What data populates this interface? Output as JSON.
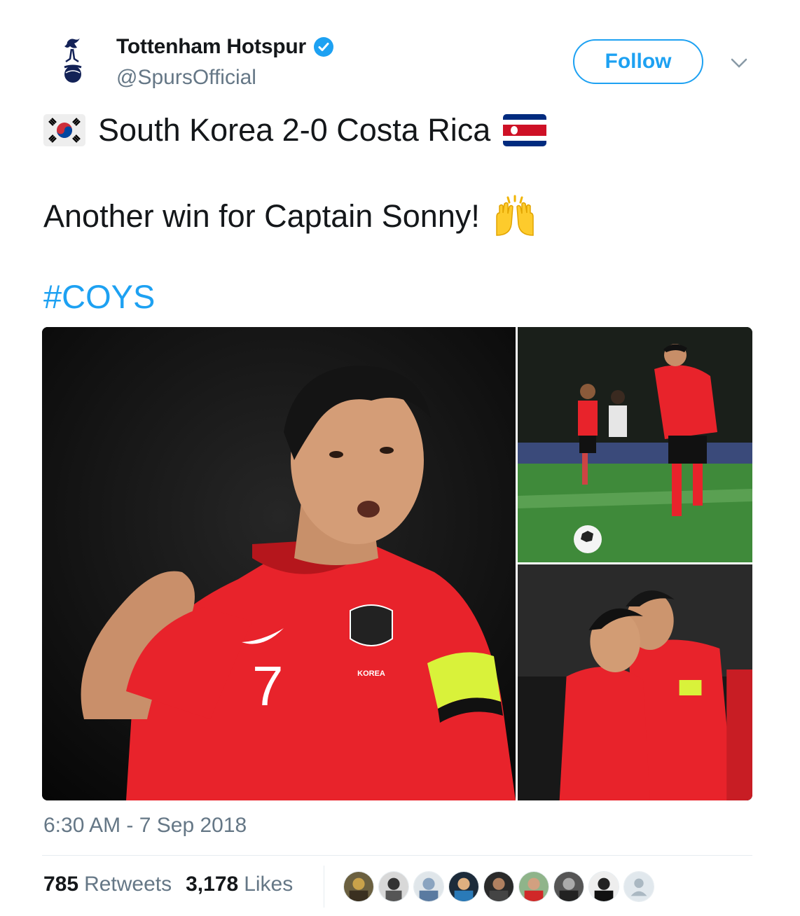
{
  "account": {
    "name": "Tottenham Hotspur",
    "handle": "@SpursOfficial",
    "follow_label": "Follow"
  },
  "tweet": {
    "line1": "South Korea 2-0 Costa Rica",
    "line2": "Another win for Captain Sonny!",
    "hashtag": "#COYS",
    "kit_text": "KOREA",
    "shirt_number": "7",
    "timestamp": "6:30 AM - 7 Sep 2018"
  },
  "stats": {
    "retweets_count": "785",
    "retweets_label": "Retweets",
    "likes_count": "3,178",
    "likes_label": "Likes"
  },
  "colors": {
    "accent": "#1da1f2",
    "text": "#14171a",
    "muted": "#657786",
    "divider": "#e6ecf0"
  },
  "icons": [
    "spurs-logo-icon",
    "verified-badge-icon",
    "chevron-down-icon",
    "south-korea-flag-icon",
    "costa-rica-flag-icon",
    "raising-hands-icon"
  ]
}
